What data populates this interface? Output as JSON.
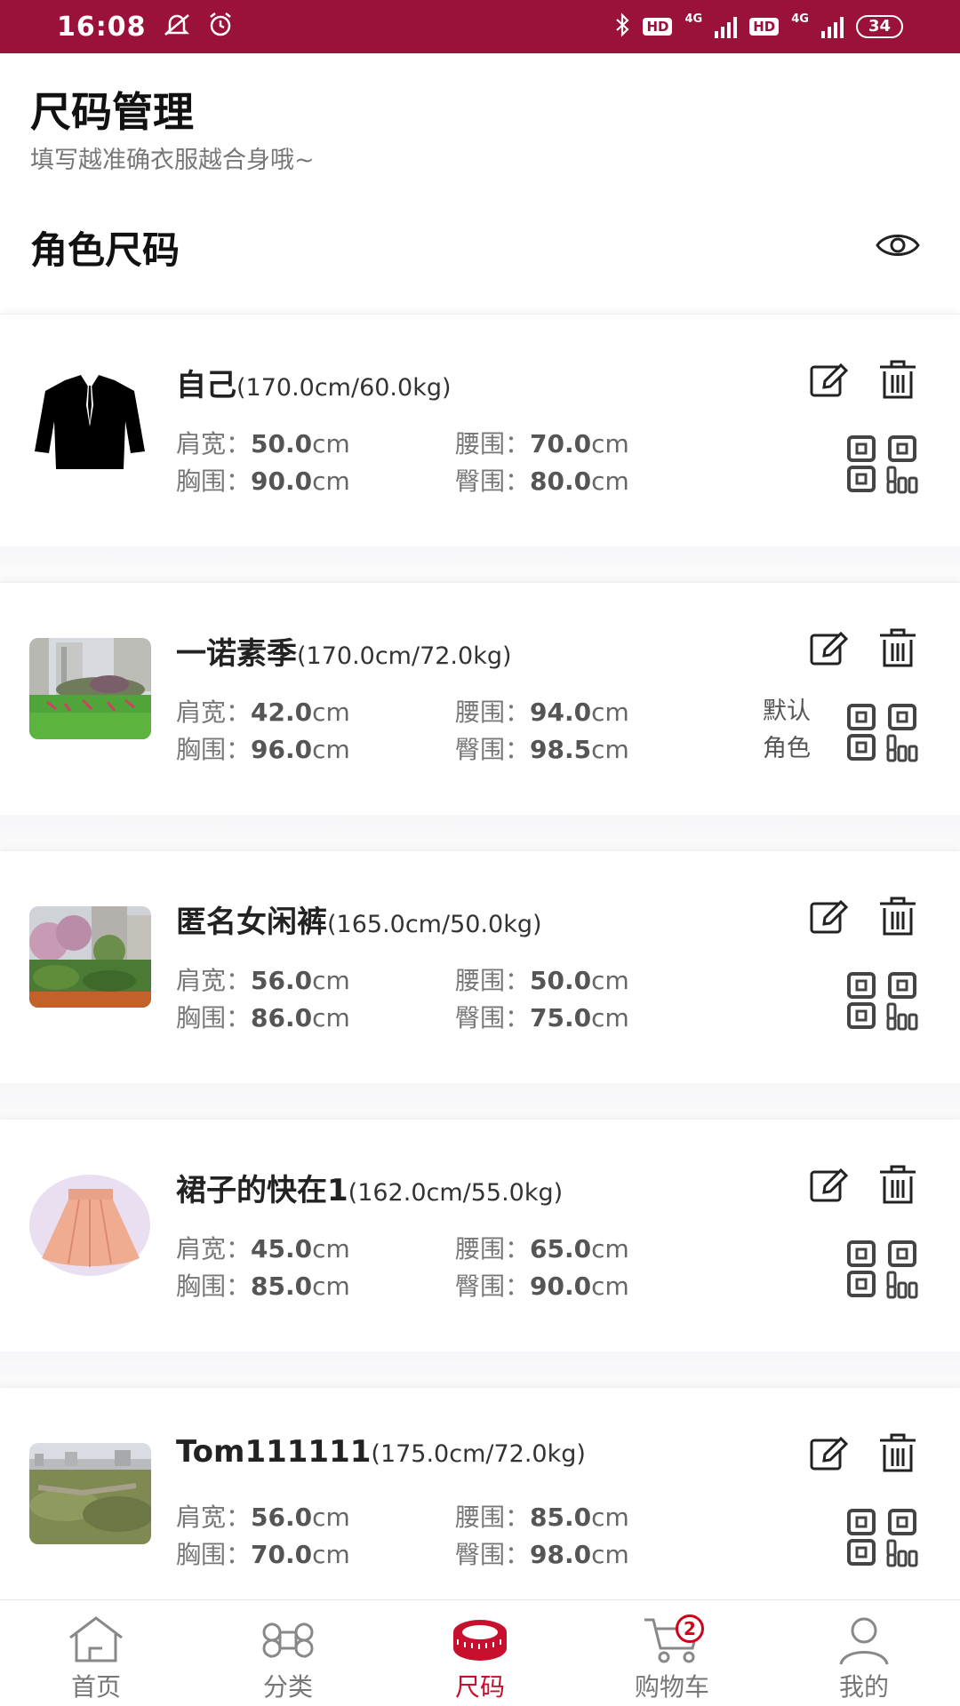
{
  "status_bar": {
    "time": "16:08",
    "hd1": "HD",
    "net1": "4G",
    "hd2": "HD",
    "net2": "4G",
    "battery": "34"
  },
  "header": {
    "title": "尺码管理",
    "subtitle": "填写越准确衣服越合身哦~",
    "section_title": "角色尺码"
  },
  "labels": {
    "shoulder": "肩宽：",
    "waist": "腰围：",
    "chest": "胸围：",
    "hip": "臀围：",
    "unit": "cm",
    "default_line1": "默认",
    "default_line2": "角色"
  },
  "profiles": [
    {
      "name": "自己",
      "hw": "(170.0cm/60.0kg)",
      "shoulder": "50.0",
      "waist": "70.0",
      "chest": "90.0",
      "hip": "80.0",
      "avatar": "suit-jacket"
    },
    {
      "name": "一诺素季",
      "hw": "(170.0cm/72.0kg)",
      "shoulder": "42.0",
      "waist": "94.0",
      "chest": "96.0",
      "hip": "98.5",
      "avatar": "garden-lawn-photo",
      "is_default": true
    },
    {
      "name": "匿名女闲裤",
      "hw": "(165.0cm/50.0kg)",
      "shoulder": "56.0",
      "waist": "50.0",
      "chest": "86.0",
      "hip": "75.0",
      "avatar": "garden-trees-photo"
    },
    {
      "name": "裙子的快在1",
      "hw": "(162.0cm/55.0kg)",
      "shoulder": "45.0",
      "waist": "65.0",
      "chest": "85.0",
      "hip": "90.0",
      "avatar": "pink-skirt"
    },
    {
      "name": "Tom111111",
      "hw": "(175.0cm/72.0kg)",
      "shoulder": "56.0",
      "waist": "85.0",
      "chest": "70.0",
      "hip": "98.0",
      "avatar": "city-field-photo"
    }
  ],
  "tabbar": {
    "items": [
      {
        "label": "首页",
        "icon": "home-icon"
      },
      {
        "label": "分类",
        "icon": "category-icon"
      },
      {
        "label": "尺码",
        "icon": "tape-measure-icon",
        "active": true
      },
      {
        "label": "购物车",
        "icon": "cart-icon",
        "badge": "2"
      },
      {
        "label": "我的",
        "icon": "user-icon"
      }
    ]
  },
  "colors": {
    "brand": "#9a1139",
    "active_tab": "#c8102e",
    "badge": "#d0021b"
  }
}
